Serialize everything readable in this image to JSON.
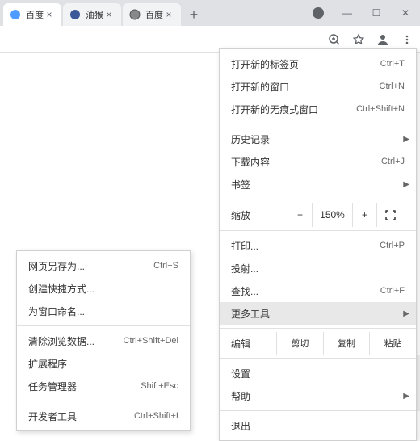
{
  "tabs": [
    {
      "title": "百度",
      "favicon": "#4e9cff"
    },
    {
      "title": "油猴",
      "favicon": "#3b5998"
    },
    {
      "title": "百度",
      "favicon": "#888"
    }
  ],
  "window_buttons": {
    "incognito": "●",
    "min": "—",
    "max": "☐",
    "close": "✕"
  },
  "toolbar_icons": {
    "zoom": "⊕",
    "star": "☆",
    "profile": "●",
    "menu": "⋮"
  },
  "main_menu": {
    "new_tab": {
      "label": "打开新的标签页",
      "sc": "Ctrl+T"
    },
    "new_window": {
      "label": "打开新的窗口",
      "sc": "Ctrl+N"
    },
    "new_incognito": {
      "label": "打开新的无痕式窗口",
      "sc": "Ctrl+Shift+N"
    },
    "history": {
      "label": "历史记录"
    },
    "downloads": {
      "label": "下载内容",
      "sc": "Ctrl+J"
    },
    "bookmarks": {
      "label": "书签"
    },
    "zoom": {
      "label": "缩放",
      "minus": "−",
      "value": "150%",
      "plus": "+"
    },
    "print": {
      "label": "打印...",
      "sc": "Ctrl+P"
    },
    "cast": {
      "label": "投射..."
    },
    "find": {
      "label": "查找...",
      "sc": "Ctrl+F"
    },
    "more_tools": {
      "label": "更多工具"
    },
    "edit": {
      "label": "编辑",
      "cut": "剪切",
      "copy": "复制",
      "paste": "粘贴"
    },
    "settings": {
      "label": "设置"
    },
    "help": {
      "label": "帮助"
    },
    "exit": {
      "label": "退出"
    }
  },
  "sub_menu": {
    "save_as": {
      "label": "网页另存为...",
      "sc": "Ctrl+S"
    },
    "create_shortcut": {
      "label": "创建快捷方式..."
    },
    "name_window": {
      "label": "为窗口命名..."
    },
    "clear_data": {
      "label": "清除浏览数据...",
      "sc": "Ctrl+Shift+Del"
    },
    "extensions": {
      "label": "扩展程序"
    },
    "task_manager": {
      "label": "任务管理器",
      "sc": "Shift+Esc"
    },
    "dev_tools": {
      "label": "开发者工具",
      "sc": "Ctrl+Shift+I"
    }
  }
}
